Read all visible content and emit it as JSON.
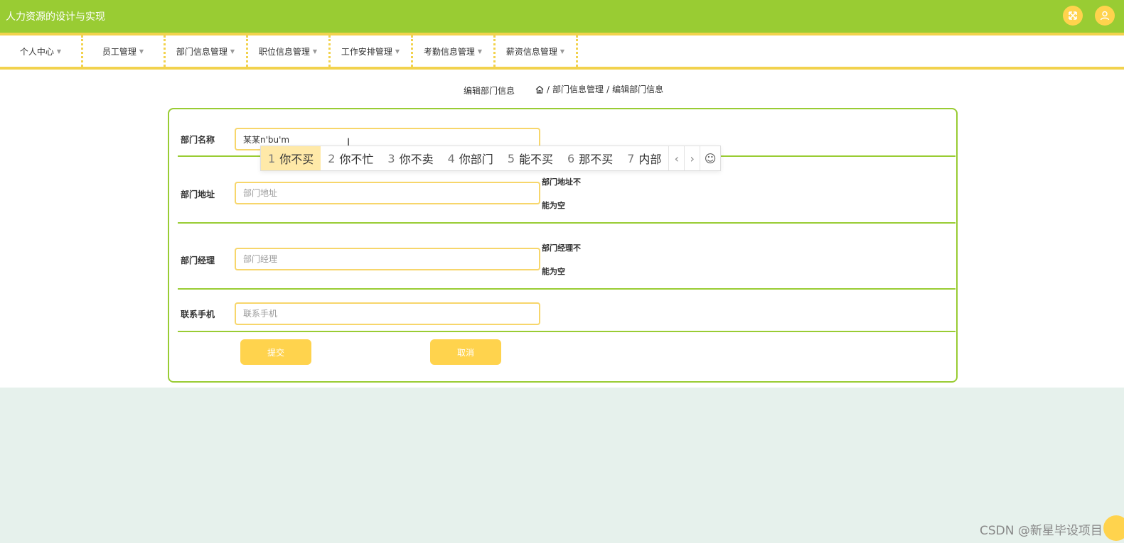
{
  "app": {
    "title": "人力资源的设计与实现"
  },
  "nav": {
    "items": [
      {
        "label": "个人中心"
      },
      {
        "label": "员工管理"
      },
      {
        "label": "部门信息管理"
      },
      {
        "label": "职位信息管理"
      },
      {
        "label": "工作安排管理"
      },
      {
        "label": "考勤信息管理"
      },
      {
        "label": "薪资信息管理"
      }
    ]
  },
  "breadcrumb": {
    "page_title": "编辑部门信息",
    "items": [
      "部门信息管理",
      "编辑部门信息"
    ],
    "separator": "/"
  },
  "form": {
    "fields": [
      {
        "label": "部门名称",
        "value": "某某n'bu'm",
        "placeholder": ""
      },
      {
        "label": "部门地址",
        "value": "",
        "placeholder": "部门地址",
        "error_line1": "部门地址不",
        "error_line2": "能为空"
      },
      {
        "label": "部门经理",
        "value": "",
        "placeholder": "部门经理",
        "error_line1": "部门经理不",
        "error_line2": "能为空"
      },
      {
        "label": "联系手机",
        "value": "",
        "placeholder": "联系手机"
      }
    ],
    "submit_label": "提交",
    "cancel_label": "取消"
  },
  "ime": {
    "candidates": [
      {
        "num": "1",
        "text": "你不买"
      },
      {
        "num": "2",
        "text": "你不忙"
      },
      {
        "num": "3",
        "text": "你不卖"
      },
      {
        "num": "4",
        "text": "你部门"
      },
      {
        "num": "5",
        "text": "能不买"
      },
      {
        "num": "6",
        "text": "那不买"
      },
      {
        "num": "7",
        "text": "内部"
      }
    ],
    "prev_icon": "‹",
    "next_icon": "›",
    "emoji_icon": "☺"
  },
  "watermark": "CSDN @新星毕设项目",
  "colors": {
    "header": "#99cc33",
    "accent": "#ffd34d",
    "border": "#f7d66b"
  }
}
